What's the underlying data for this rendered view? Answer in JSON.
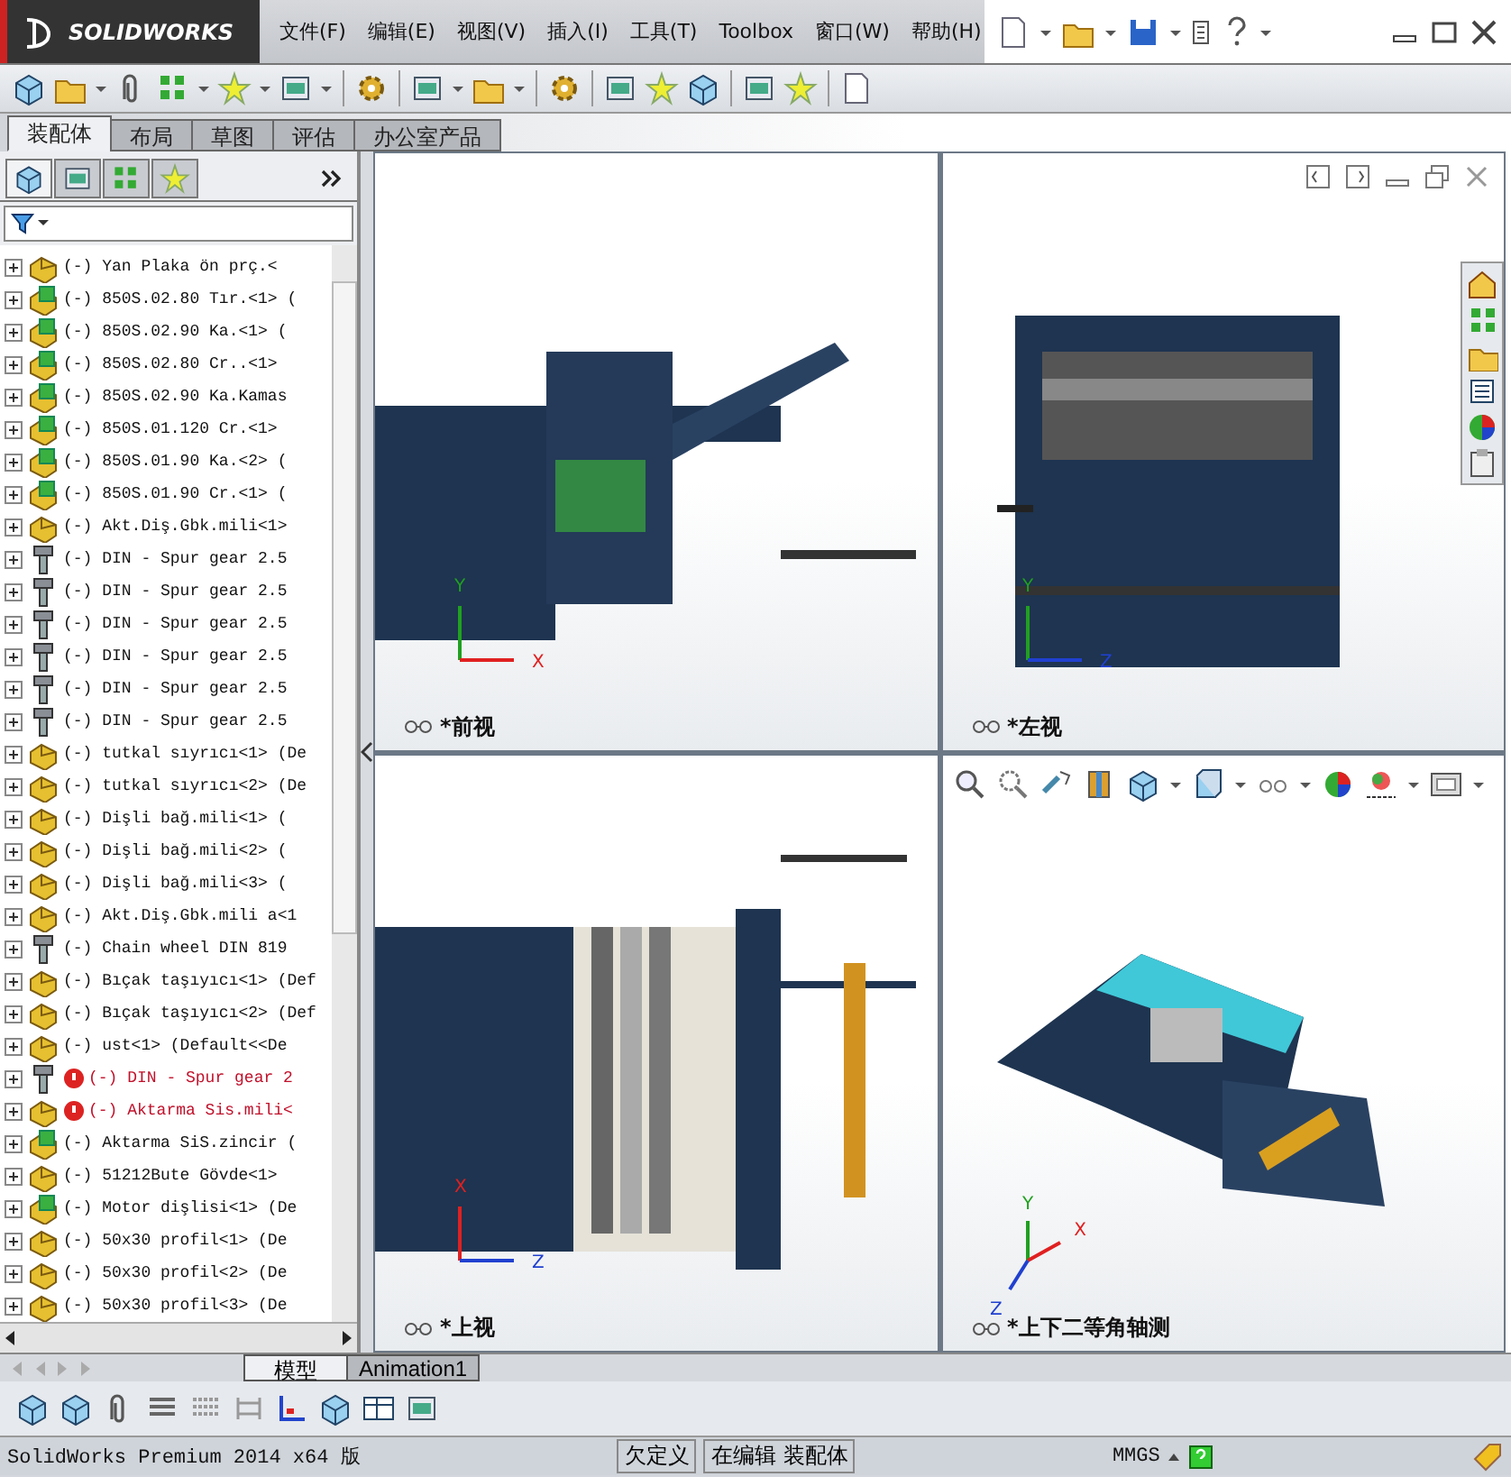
{
  "app": {
    "logo": "SOLIDWORKS"
  },
  "menu": [
    {
      "label": "文件(F)"
    },
    {
      "label": "编辑(E)"
    },
    {
      "label": "视图(V)"
    },
    {
      "label": "插入(I)"
    },
    {
      "label": "工具(T)"
    },
    {
      "label": "Toolbox"
    },
    {
      "label": "窗口(W)"
    },
    {
      "label": "帮助(H)"
    }
  ],
  "command_tabs": [
    {
      "label": "装配体",
      "selected": true
    },
    {
      "label": "布局",
      "selected": false
    },
    {
      "label": "草图",
      "selected": false
    },
    {
      "label": "评估",
      "selected": false
    },
    {
      "label": "办公室产品",
      "selected": false
    }
  ],
  "panel_tabs": [
    {
      "kind": "tree",
      "selected": true
    },
    {
      "kind": "properties",
      "selected": false
    },
    {
      "kind": "config",
      "selected": false
    },
    {
      "kind": "display",
      "selected": false
    }
  ],
  "tree": {
    "rows": [
      {
        "kind": "part",
        "label": "(-) Yan Plaka  ön prç.<",
        "error": false
      },
      {
        "kind": "assembly",
        "label": "(-) 850S.02.80 Tır.<1> (",
        "error": false
      },
      {
        "kind": "assembly",
        "label": "(-) 850S.02.90 Ka.<1> (",
        "error": false
      },
      {
        "kind": "assembly",
        "label": "(-) 850S.02.80 Cr..<1>",
        "error": false
      },
      {
        "kind": "assembly",
        "label": "(-) 850S.02.90 Ka.Kamas",
        "error": false
      },
      {
        "kind": "assembly",
        "label": "(-) 850S.01.120 Cr.<1>",
        "error": false
      },
      {
        "kind": "assembly",
        "label": "(-) 850S.01.90 Ka.<2> (",
        "error": false
      },
      {
        "kind": "assembly",
        "label": "(-) 850S.01.90 Cr.<1> (",
        "error": false
      },
      {
        "kind": "part",
        "label": "(-) Akt.Diş.Gbk.mili<1>",
        "error": false
      },
      {
        "kind": "bolt",
        "label": "(-) DIN - Spur gear 2.5",
        "error": false
      },
      {
        "kind": "bolt",
        "label": "(-) DIN - Spur gear 2.5",
        "error": false
      },
      {
        "kind": "bolt",
        "label": "(-) DIN - Spur gear 2.5",
        "error": false
      },
      {
        "kind": "bolt",
        "label": "(-) DIN - Spur gear 2.5",
        "error": false
      },
      {
        "kind": "bolt",
        "label": "(-) DIN - Spur gear 2.5",
        "error": false
      },
      {
        "kind": "bolt",
        "label": "(-) DIN - Spur gear 2.5",
        "error": false
      },
      {
        "kind": "part",
        "label": "(-) tutkal sıyrıcı<1> (De",
        "error": false
      },
      {
        "kind": "part",
        "label": "(-) tutkal sıyrıcı<2> (De",
        "error": false
      },
      {
        "kind": "part",
        "label": "(-) Dişli bağ.mili<1> (",
        "error": false
      },
      {
        "kind": "part",
        "label": "(-) Dişli bağ.mili<2> (",
        "error": false
      },
      {
        "kind": "part",
        "label": "(-) Dişli bağ.mili<3> (",
        "error": false
      },
      {
        "kind": "part",
        "label": "(-) Akt.Diş.Gbk.mili a<1",
        "error": false
      },
      {
        "kind": "bolt",
        "label": "(-) Chain wheel DIN 819",
        "error": false
      },
      {
        "kind": "part",
        "label": "(-) Bıçak taşıyıcı<1> (Def",
        "error": false
      },
      {
        "kind": "part",
        "label": "(-) Bıçak taşıyıcı<2> (Def",
        "error": false
      },
      {
        "kind": "part",
        "label": "(-) ust<1> (Default<<De",
        "error": false
      },
      {
        "kind": "bolt",
        "label": "(-) DIN - Spur gear 2",
        "error": true
      },
      {
        "kind": "part",
        "label": "(-) Aktarma Sis.mili<",
        "error": true
      },
      {
        "kind": "assembly",
        "label": "(-) Aktarma SiS.zincir (",
        "error": false
      },
      {
        "kind": "part",
        "label": "(-) 51212Bute Gövde<1>",
        "error": false
      },
      {
        "kind": "assembly",
        "label": "(-) Motor dişlisi<1> (De",
        "error": false
      },
      {
        "kind": "part",
        "label": "(-) 50x30 profil<1> (De",
        "error": false
      },
      {
        "kind": "part",
        "label": "(-) 50x30 profil<2> (De",
        "error": false
      },
      {
        "kind": "part",
        "label": "(-) 50x30 profil<3> (De",
        "error": false
      }
    ]
  },
  "viewports": [
    {
      "label": "*前视",
      "axes": [
        "Y",
        "X"
      ]
    },
    {
      "label": "*左视",
      "axes": [
        "Y",
        "Z"
      ]
    },
    {
      "label": "*上视",
      "axes": [
        "X",
        "Z"
      ]
    },
    {
      "label": "*上下二等角轴测",
      "axes": [
        "Y",
        "X",
        "Z"
      ]
    }
  ],
  "bottom_tabs": [
    {
      "label": "模型",
      "selected": true
    },
    {
      "label": "Animation1",
      "selected": false
    }
  ],
  "status_bar": {
    "product": "SolidWorks Premium 2014 x64 版",
    "state": "欠定义",
    "mode": "在编辑 装配体",
    "units": "MMGS"
  }
}
